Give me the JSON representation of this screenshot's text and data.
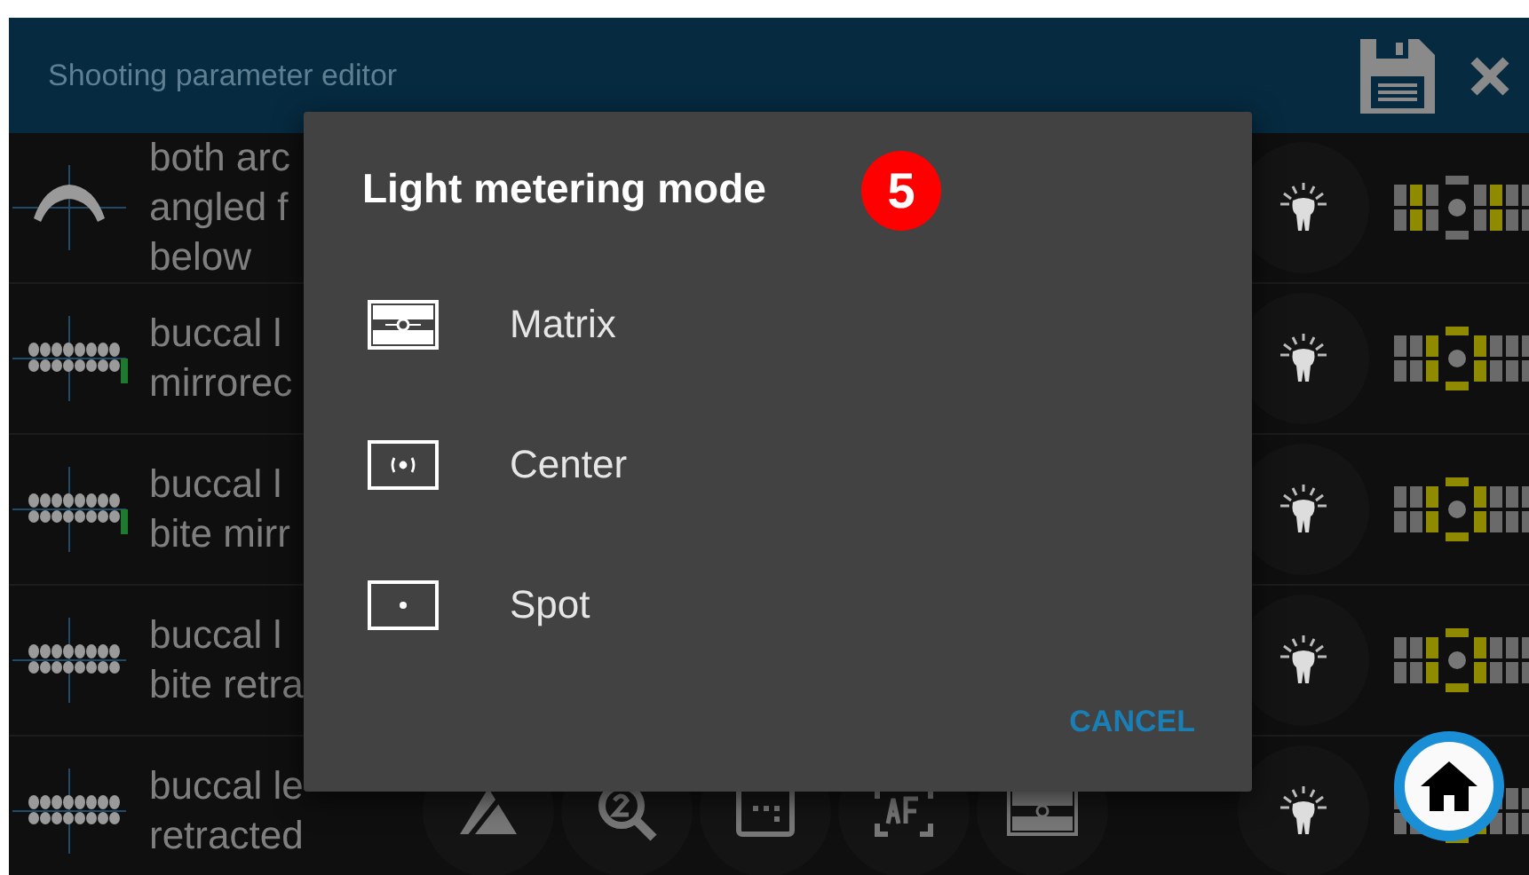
{
  "header": {
    "title": "Shooting parameter editor"
  },
  "rows": [
    {
      "lines": [
        "both arc",
        "angled f",
        "below"
      ],
      "kind": "arch",
      "marker": false,
      "center_highlight": false
    },
    {
      "lines": [
        "buccal l",
        "mirrorec"
      ],
      "kind": "buccal",
      "marker": true,
      "center_highlight": true
    },
    {
      "lines": [
        "buccal l",
        "bite mirr"
      ],
      "kind": "buccal",
      "marker": true,
      "center_highlight": true
    },
    {
      "lines": [
        "buccal l",
        "bite retra"
      ],
      "kind": "buccal",
      "marker": false,
      "center_highlight": true
    },
    {
      "lines": [
        "buccal le",
        "retracted"
      ],
      "kind": "buccal",
      "marker": false,
      "center_highlight": true
    }
  ],
  "dialog": {
    "title": "Light metering mode",
    "badge": "5",
    "options": [
      {
        "kind": "matrix",
        "label": "Matrix"
      },
      {
        "kind": "center",
        "label": "Center"
      },
      {
        "kind": "spot",
        "label": "Spot"
      }
    ],
    "cancel": "CANCEL"
  }
}
